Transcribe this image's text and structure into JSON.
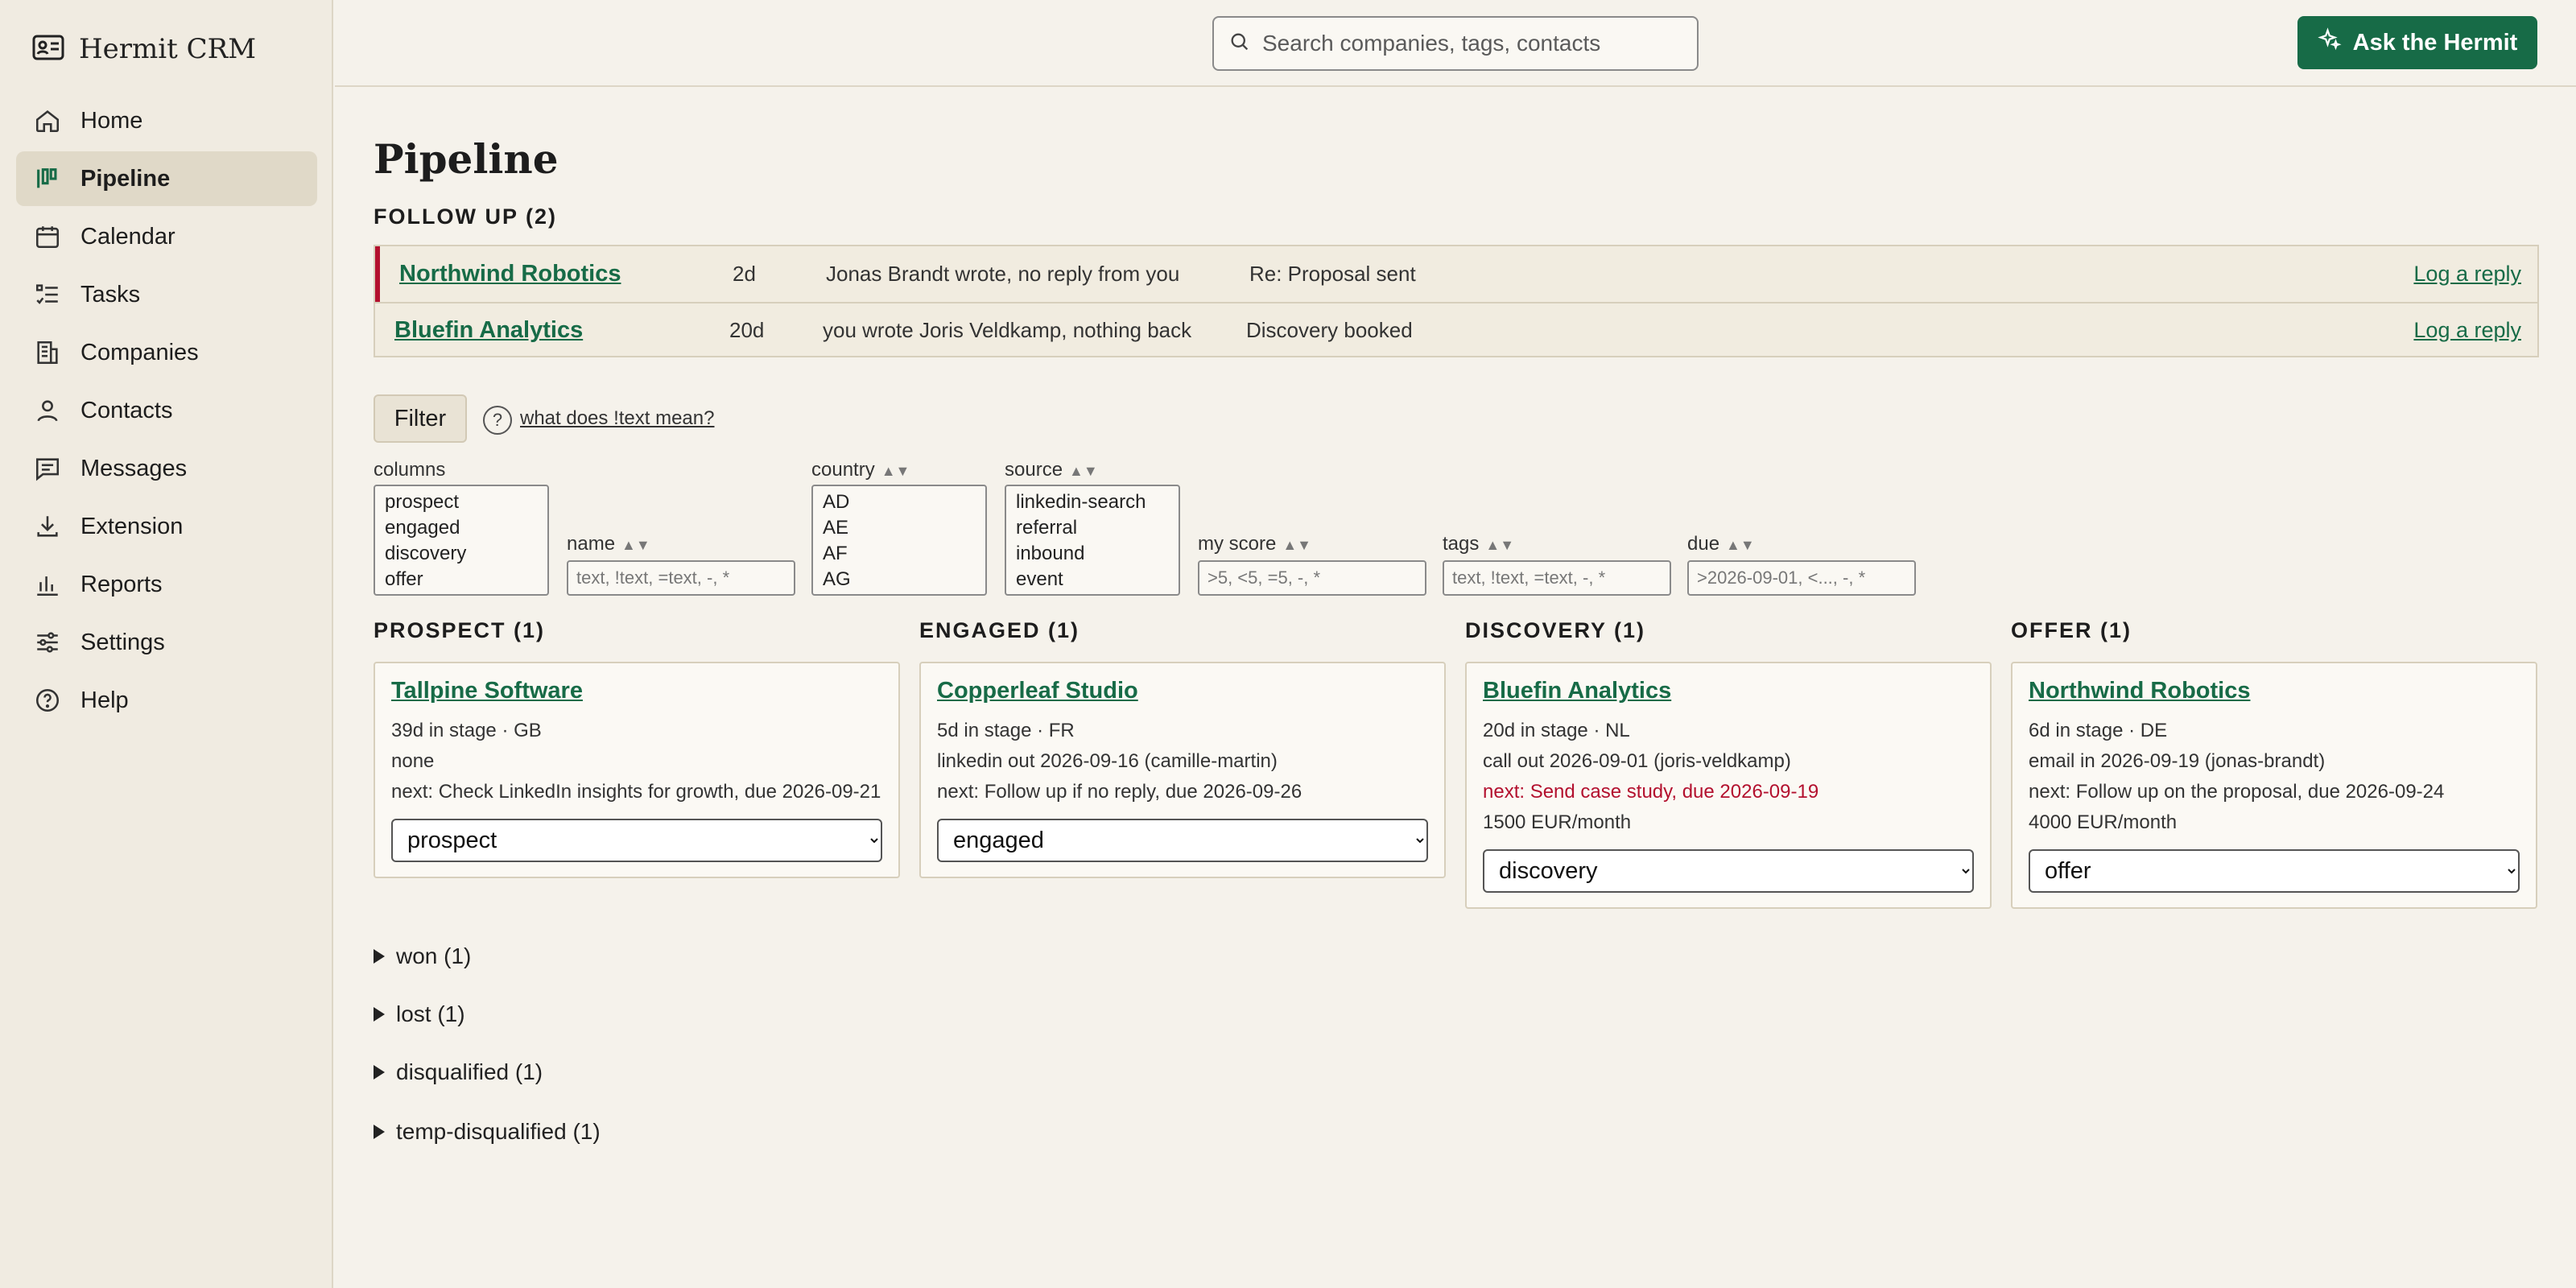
{
  "app": {
    "name": "Hermit CRM"
  },
  "sidebar": {
    "items": [
      {
        "label": "Home",
        "icon": "home-icon",
        "active": false
      },
      {
        "label": "Pipeline",
        "icon": "kanban-icon",
        "active": true
      },
      {
        "label": "Calendar",
        "icon": "calendar-icon",
        "active": false
      },
      {
        "label": "Tasks",
        "icon": "tasks-icon",
        "active": false
      },
      {
        "label": "Companies",
        "icon": "building-icon",
        "active": false
      },
      {
        "label": "Contacts",
        "icon": "user-icon",
        "active": false
      },
      {
        "label": "Messages",
        "icon": "message-icon",
        "active": false
      },
      {
        "label": "Extension",
        "icon": "download-icon",
        "active": false
      },
      {
        "label": "Reports",
        "icon": "bar-chart-icon",
        "active": false
      },
      {
        "label": "Settings",
        "icon": "sliders-icon",
        "active": false
      },
      {
        "label": "Help",
        "icon": "help-icon",
        "active": false
      }
    ]
  },
  "topbar": {
    "search_placeholder": "Search companies, tags, contacts",
    "ask_label": "Ask the Hermit"
  },
  "page": {
    "title": "Pipeline"
  },
  "followup": {
    "title": "FOLLOW UP (2)",
    "rows": [
      {
        "company": "Northwind Robotics",
        "age": "2d",
        "message": "Jonas Brandt wrote, no reply from you",
        "subject": "Re: Proposal sent",
        "action": "Log a reply",
        "urgent": true
      },
      {
        "company": "Bluefin Analytics",
        "age": "20d",
        "message": "you wrote Joris Veldkamp, nothing back",
        "subject": "Discovery booked",
        "action": "Log a reply",
        "urgent": false
      }
    ]
  },
  "filters": {
    "filter_label": "Filter",
    "help_glyph": "?",
    "help_link": "what does !text mean?",
    "sort_glyph": "▲▼",
    "columns": {
      "label": "columns",
      "options": [
        "prospect",
        "engaged",
        "discovery",
        "offer"
      ]
    },
    "name": {
      "label": "name",
      "placeholder": "text, !text, =text, -, *"
    },
    "country": {
      "label": "country",
      "options": [
        "AD",
        "AE",
        "AF",
        "AG"
      ]
    },
    "source": {
      "label": "source",
      "options": [
        "linkedin-search",
        "referral",
        "inbound",
        "event"
      ]
    },
    "score": {
      "label": "my score",
      "placeholder": ">5, <5, =5, -, *"
    },
    "tags": {
      "label": "tags",
      "placeholder": "text, !text, =text, -, *"
    },
    "due": {
      "label": "due",
      "placeholder": ">2026-09-01, <..., -, *"
    }
  },
  "stages": [
    {
      "title": "PROSPECT (1)",
      "card": {
        "company": "Tallpine Software",
        "lines": [
          {
            "text": "39d in stage · GB",
            "red": false
          },
          {
            "text": "none",
            "red": false
          },
          {
            "text": "next: Check LinkedIn insights for growth, due 2026-09-21",
            "red": false
          }
        ],
        "stage": "prospect"
      }
    },
    {
      "title": "ENGAGED (1)",
      "card": {
        "company": "Copperleaf Studio",
        "lines": [
          {
            "text": "5d in stage · FR",
            "red": false
          },
          {
            "text": "linkedin out 2026-09-16 (camille-martin)",
            "red": false
          },
          {
            "text": "next: Follow up if no reply, due 2026-09-26",
            "red": false
          }
        ],
        "stage": "engaged"
      }
    },
    {
      "title": "DISCOVERY (1)",
      "card": {
        "company": "Bluefin Analytics",
        "lines": [
          {
            "text": "20d in stage · NL",
            "red": false
          },
          {
            "text": "call out 2026-09-01 (joris-veldkamp)",
            "red": false
          },
          {
            "text": "next: Send case study, due 2026-09-19",
            "red": true
          },
          {
            "text": "1500 EUR/month",
            "red": false
          }
        ],
        "stage": "discovery"
      }
    },
    {
      "title": "OFFER (1)",
      "card": {
        "company": "Northwind Robotics",
        "lines": [
          {
            "text": "6d in stage · DE",
            "red": false
          },
          {
            "text": "email in 2026-09-19 (jonas-brandt)",
            "red": false
          },
          {
            "text": "next: Follow up on the proposal, due 2026-09-24",
            "red": false
          },
          {
            "text": "4000 EUR/month",
            "red": false
          }
        ],
        "stage": "offer"
      }
    }
  ],
  "collapsed": [
    {
      "label": "won (1)"
    },
    {
      "label": "lost (1)"
    },
    {
      "label": "disqualified (1)"
    },
    {
      "label": "temp-disqualified (1)"
    }
  ],
  "colors": {
    "accent": "#176b47",
    "urgent": "#b3102e",
    "background": "#f5f2eb",
    "sidebar": "#f0ebe1"
  }
}
